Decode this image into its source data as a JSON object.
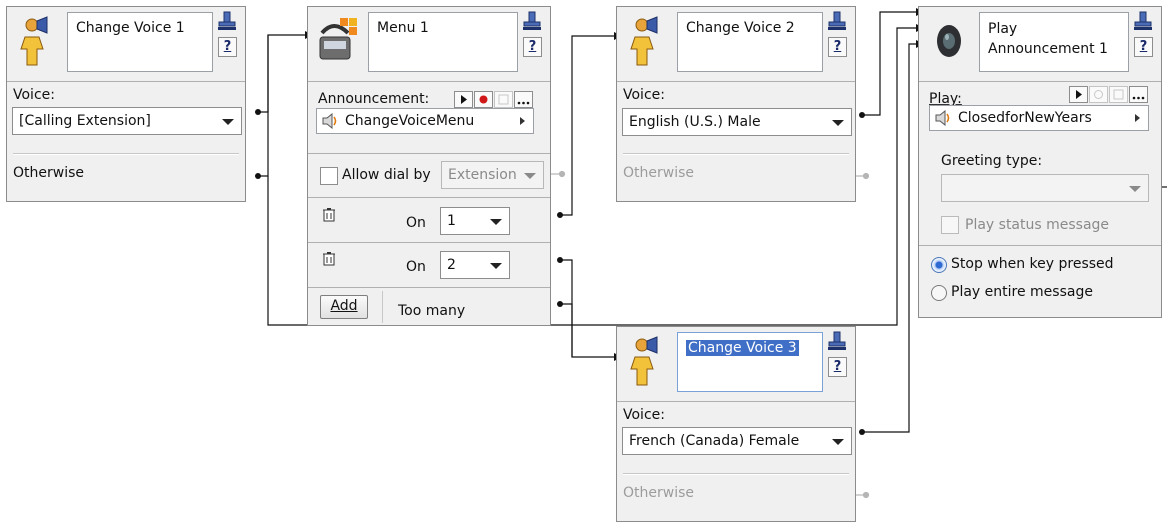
{
  "nodes": {
    "change_voice_1": {
      "title": "Change Voice 1",
      "voice_label": "Voice:",
      "voice_value": "[Calling Extension]",
      "otherwise": "Otherwise",
      "icon": "speaker-person-icon"
    },
    "menu_1": {
      "title": "Menu 1",
      "announcement_label": "Announcement:",
      "announcement_value": "ChangeVoiceMenu",
      "allow_dial_label": "Allow dial by",
      "allow_dial_value": "Extension",
      "options": [
        {
          "on_label": "On",
          "key": "1"
        },
        {
          "on_label": "On",
          "key": "2"
        }
      ],
      "add_label": "Add",
      "too_many": "Too many",
      "icon": "menu-phone-icon"
    },
    "change_voice_2": {
      "title": "Change Voice 2",
      "voice_label": "Voice:",
      "voice_value": "English (U.S.) Male",
      "otherwise": "Otherwise",
      "icon": "speaker-person-icon"
    },
    "change_voice_3": {
      "title": "Change Voice 3",
      "voice_label": "Voice:",
      "voice_value": "French (Canada) Female",
      "otherwise": "Otherwise",
      "icon": "speaker-person-icon"
    },
    "play_announcement_1": {
      "title": "Play Announcement 1",
      "title_line1": "Play",
      "title_line2": "Announcement 1",
      "play_label": "Play:",
      "play_value": "ClosedforNewYears",
      "greeting_label": "Greeting type:",
      "greeting_value": "",
      "status_label": "Play status message",
      "radio_stop": "Stop when key pressed",
      "radio_play_entire": "Play entire message",
      "radio_selected": "stop",
      "icon": "loudspeaker-icon"
    }
  },
  "common": {
    "help_label": "?"
  },
  "colors": {
    "selection": "#3f6fc6",
    "node_bg": "#f0f0f0",
    "wire": "#111111"
  }
}
